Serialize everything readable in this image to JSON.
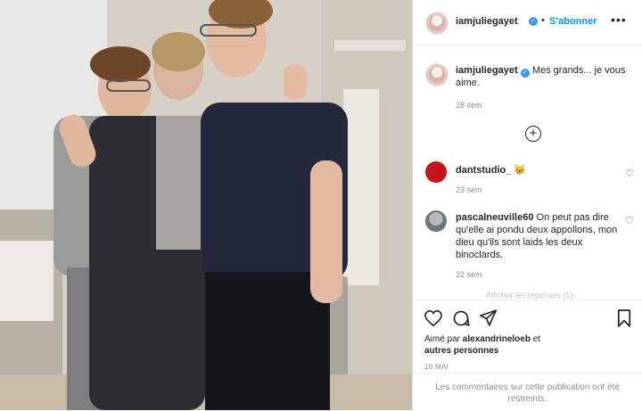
{
  "post": {
    "username": "iamjuliegayet",
    "follow_label": "S'abonner",
    "separator": "•",
    "more_label": "•••"
  },
  "caption": {
    "username": "iamjuliegayet",
    "text": "Mes grands... je vous aime.",
    "time": "28 sem"
  },
  "comments": [
    {
      "username": "dantstudio_",
      "text": "😸",
      "time": "23 sem",
      "avatar_color": "#c4161c"
    },
    {
      "username": "pascalneuville60",
      "text": "On peut pas dire qu'elle ai pondu deux appollons, mon dieu qu'ils sont laids les deux binoclards.",
      "time": "22 sem",
      "avatar_color": "#8a8f94"
    }
  ],
  "load_more_faded": "Afficher les réponses (1)",
  "likes": {
    "prefix": "Aimé par",
    "user": "alexandrineloeb",
    "suffix": "et",
    "others": "autres personnes"
  },
  "date": "10 MAI",
  "restricted_text": "Les commentaires sur cette publication ont été restreints.",
  "colors": {
    "link": "#0095f6",
    "muted": "#8e8e8e",
    "text": "#262626",
    "verified": "#3897f0"
  },
  "icons": [
    "verified-badge-icon",
    "more-options-icon",
    "add-comment-icon",
    "heart-icon",
    "comment-icon",
    "share-icon",
    "bookmark-icon"
  ]
}
